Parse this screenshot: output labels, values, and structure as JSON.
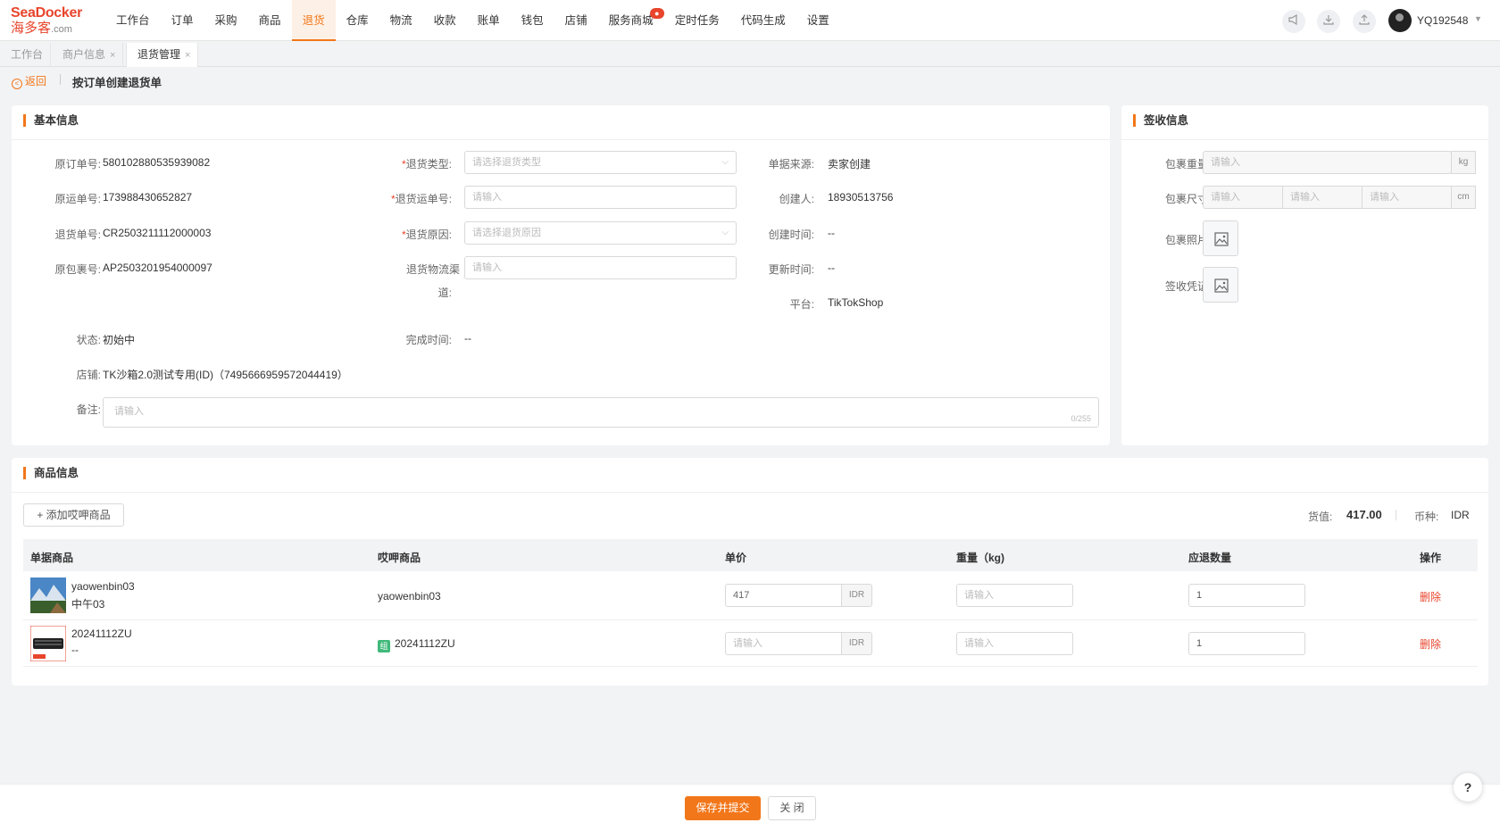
{
  "logo": {
    "brand": "SeaDocker",
    "cn": "海多客",
    "suffix": ".com"
  },
  "nav": [
    {
      "label": "工作台"
    },
    {
      "label": "订单"
    },
    {
      "label": "采购"
    },
    {
      "label": "商品"
    },
    {
      "label": "退货",
      "active": true
    },
    {
      "label": "仓库"
    },
    {
      "label": "物流"
    },
    {
      "label": "收款"
    },
    {
      "label": "账单"
    },
    {
      "label": "钱包"
    },
    {
      "label": "店铺"
    },
    {
      "label": "服务商城",
      "badge": "●"
    },
    {
      "label": "定时任务"
    },
    {
      "label": "代码生成"
    },
    {
      "label": "设置"
    }
  ],
  "user": {
    "name": "YQ192548"
  },
  "tabs": [
    {
      "label": "工作台"
    },
    {
      "label": "商户信息",
      "close": "×"
    },
    {
      "label": "退货管理",
      "close": "×"
    }
  ],
  "breadcrumb": {
    "back": "返回",
    "title": "按订单创建退货单"
  },
  "basic": {
    "title": "基本信息",
    "orig_order_label": "原订单号:",
    "orig_order": "580102880535939082",
    "orig_waybill_label": "原运单号:",
    "orig_waybill": "173988430652827",
    "return_no_label": "退货单号:",
    "return_no": "CR2503211112000003",
    "orig_pkg_label": "原包裹号:",
    "orig_pkg": "AP2503201954000097",
    "status_label": "状态:",
    "status": "初始中",
    "shop_label": "店铺:",
    "shop": "TK沙箱2.0测试专用(ID)（7495666959572044419）",
    "remark_label": "备注:",
    "remark_placeholder": "请输入",
    "remark_count": "0/255",
    "return_type_label": "退货类型:",
    "return_type_placeholder": "请选择退货类型",
    "return_waybill_label": "退货运单号:",
    "return_waybill_placeholder": "请输入",
    "return_reason_label": "退货原因:",
    "return_reason_placeholder": "请选择退货原因",
    "logistics_label_1": "退货物流渠",
    "logistics_label_2": "道:",
    "logistics_placeholder": "请输入",
    "finish_label": "完成时间:",
    "finish": "--",
    "source_label": "单据来源:",
    "source": "卖家创建",
    "creator_label": "创建人:",
    "creator": "18930513756",
    "created_label": "创建时间:",
    "created": "--",
    "updated_label": "更新时间:",
    "updated": "--",
    "platform_label": "平台:",
    "platform": "TikTokShop",
    "required_mark": "*"
  },
  "receipt": {
    "title": "签收信息",
    "weight_label": "包裹重量",
    "weight_placeholder": "请输入",
    "weight_unit": "kg",
    "size_label": "包裹尺寸",
    "size_placeholder": "请输入",
    "size_unit": "cm",
    "photo_label": "包裹照片",
    "proof_label": "签收凭证"
  },
  "goods": {
    "title": "商品信息",
    "add_button": "添加哎呷商品",
    "value_label": "货值:",
    "value": "417.00",
    "currency_label": "币种:",
    "currency": "IDR",
    "columns": [
      "单据商品",
      "哎呷商品",
      "单价",
      "重量（kg)",
      "应退数量",
      "操作"
    ],
    "rows": [
      {
        "sku": "yaowenbin03",
        "name": "中午03",
        "mapped": "yaowenbin03",
        "price": "417",
        "price_unit": "IDR",
        "weight_placeholder": "请输入",
        "qty": "1",
        "action": "删除"
      },
      {
        "sku": "20241112ZU",
        "name": "--",
        "combo": "组",
        "mapped": "20241112ZU",
        "price_placeholder": "请输入",
        "price_unit": "IDR",
        "weight_placeholder": "请输入",
        "qty": "1",
        "action": "删除"
      }
    ]
  },
  "footer": {
    "submit": "保存并提交",
    "close": "关 闭"
  },
  "help": "?",
  "colors": {
    "accent": "#f2771a",
    "danger": "#e8452c",
    "combo": "#3fb979"
  }
}
